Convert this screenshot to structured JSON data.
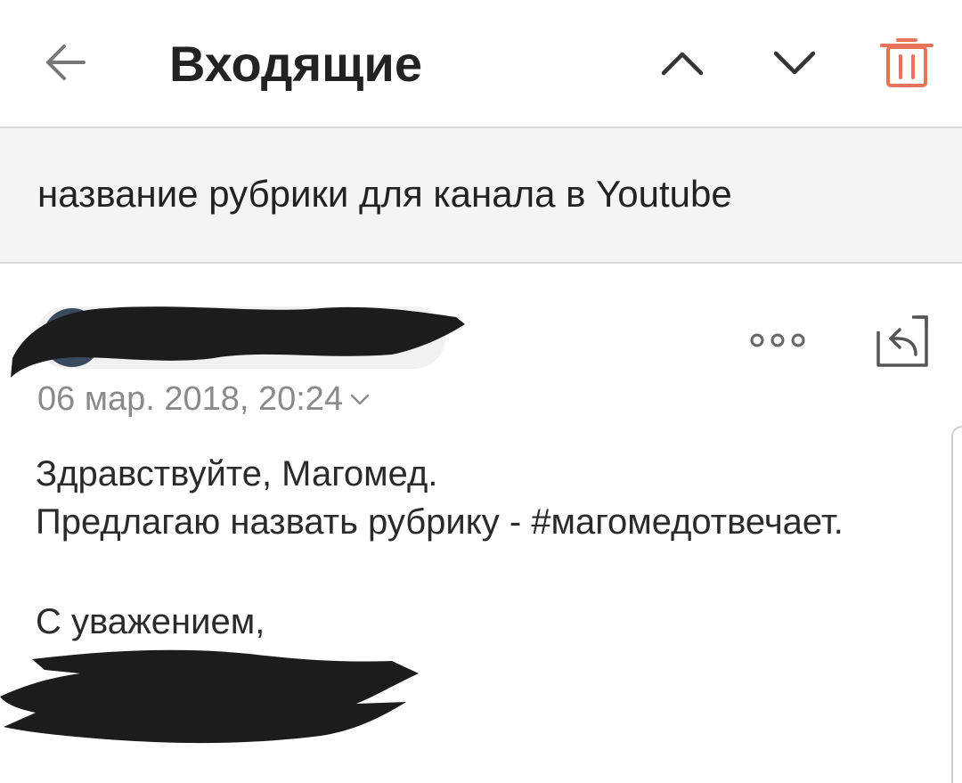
{
  "header": {
    "title": "Входящие",
    "back_icon": "arrow-left-icon",
    "prev_icon": "chevron-up-icon",
    "next_icon": "chevron-down-icon",
    "delete_icon": "trash-icon",
    "accent_color": "#e8735b"
  },
  "subject": {
    "text": "название рубрики для канала в Youtube"
  },
  "message": {
    "more_icon": "more-dots-icon",
    "reply_icon": "reply-icon",
    "date": "06 мар. 2018, 20:24",
    "date_toggle_icon": "chevron-down-icon",
    "body": {
      "greeting": "Здравствуйте, Магомед.",
      "text": "Предлагаю назвать рубрику - #магомедотвечает.",
      "closing": "С уважением,"
    }
  }
}
